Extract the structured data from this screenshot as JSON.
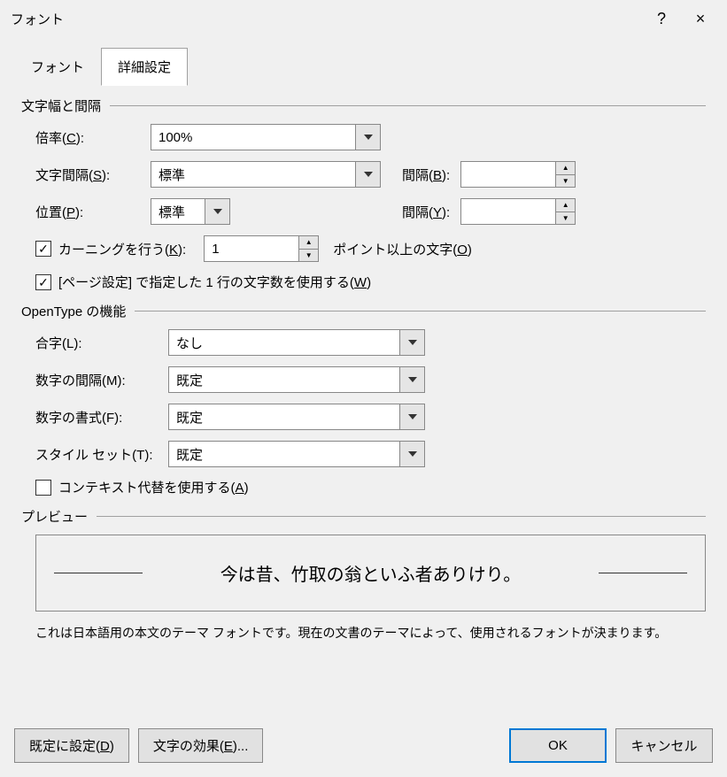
{
  "window": {
    "title": "フォント",
    "help": "?",
    "close": "×"
  },
  "tabs": {
    "font": "フォント",
    "advanced": "詳細設定"
  },
  "spacing_group": {
    "title": "文字幅と間隔",
    "scale_label": "倍率(C):",
    "scale_value": "100%",
    "spacing_label": "文字間隔(S):",
    "spacing_value": "標準",
    "by_label_b": "間隔(B):",
    "by_value_b": "",
    "position_label": "位置(P):",
    "position_value": "標準",
    "by_label_y": "間隔(Y):",
    "by_value_y": "",
    "kerning_label": "カーニングを行う(K):",
    "kerning_value": "1",
    "kerning_after": "ポイント以上の文字(O)",
    "usepage_label": "[ページ設定] で指定した 1 行の文字数を使用する(W)"
  },
  "opentype_group": {
    "title": "OpenType の機能",
    "ligatures_label": "合字(L):",
    "ligatures_value": "なし",
    "numspacing_label": "数字の間隔(M):",
    "numspacing_value": "既定",
    "numforms_label": "数字の書式(F):",
    "numforms_value": "既定",
    "styleset_label": "スタイル セット(T):",
    "styleset_value": "既定",
    "context_label": "コンテキスト代替を使用する(A)"
  },
  "preview": {
    "title": "プレビュー",
    "text": "今は昔、竹取の翁といふ者ありけり。",
    "desc": "これは日本語用の本文のテーマ フォントです。現在の文書のテーマによって、使用されるフォントが決まります。"
  },
  "buttons": {
    "setdefault": "既定に設定(D)",
    "texteffects": "文字の効果(E)...",
    "ok": "OK",
    "cancel": "キャンセル"
  }
}
